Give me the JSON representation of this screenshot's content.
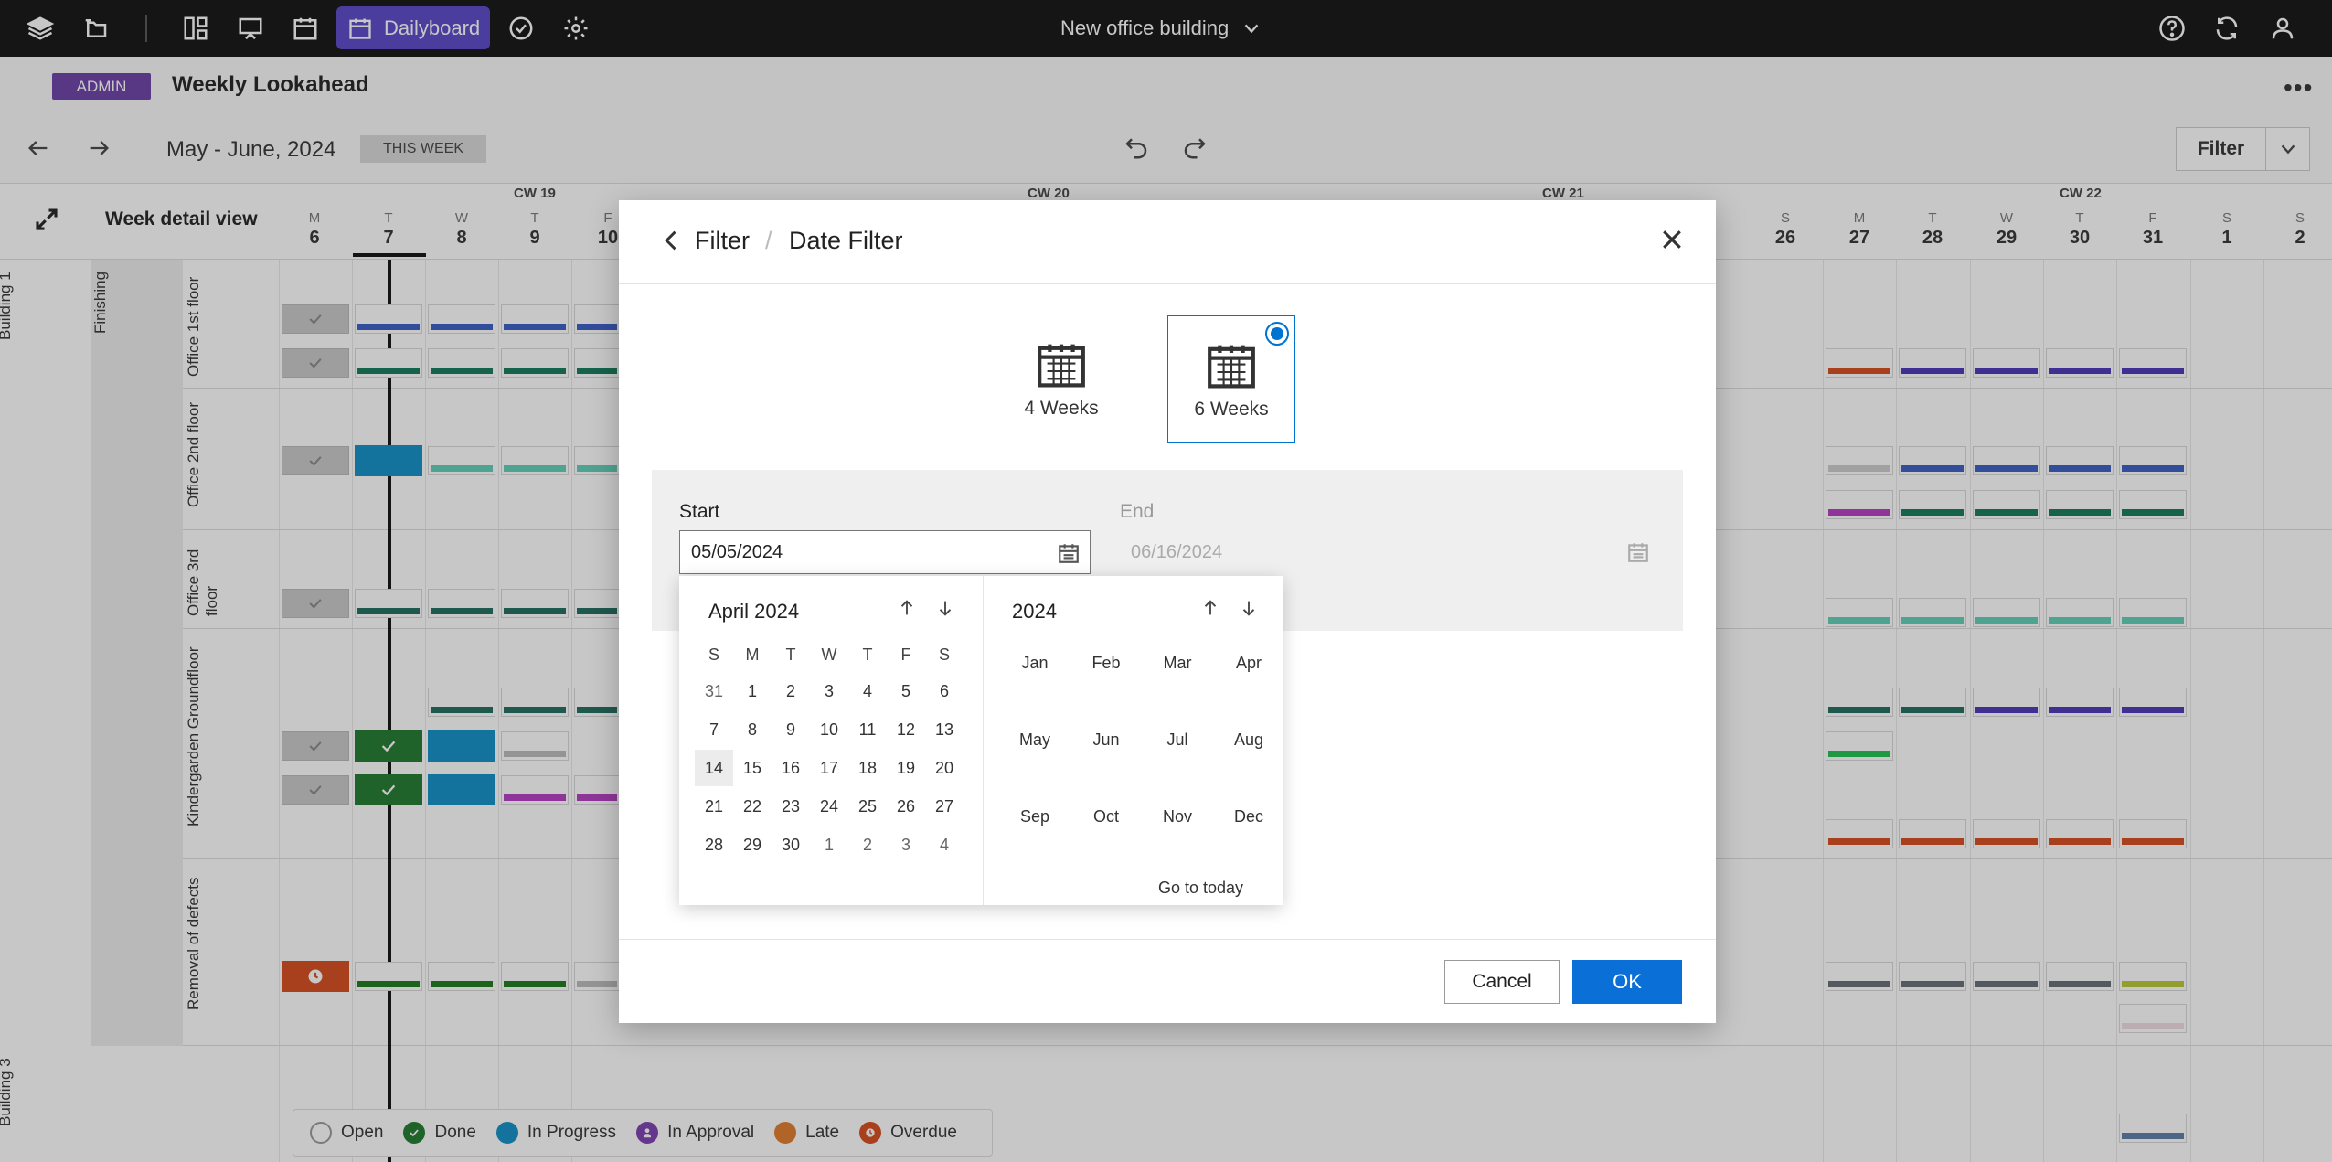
{
  "topbar": {
    "app_tab": "Dailyboard",
    "project_name": "New office building"
  },
  "header": {
    "role_badge": "ADMIN",
    "title": "Weekly Lookahead",
    "date_range": "May - June, 2024",
    "this_week": "THIS WEEK",
    "filter_label": "Filter"
  },
  "grid": {
    "view_label": "Week detail view",
    "calendar_weeks": [
      "CW 19",
      "CW 20",
      "CW 21",
      "CW 22"
    ],
    "days_left": [
      {
        "d": "M",
        "n": "6"
      },
      {
        "d": "T",
        "n": "7"
      },
      {
        "d": "W",
        "n": "8"
      },
      {
        "d": "T",
        "n": "9"
      },
      {
        "d": "F",
        "n": "10"
      }
    ],
    "days_right": [
      {
        "d": "S",
        "n": "26"
      },
      {
        "d": "M",
        "n": "27"
      },
      {
        "d": "T",
        "n": "28"
      },
      {
        "d": "W",
        "n": "29"
      },
      {
        "d": "T",
        "n": "30"
      },
      {
        "d": "F",
        "n": "31"
      },
      {
        "d": "S",
        "n": "1"
      },
      {
        "d": "S",
        "n": "2"
      }
    ],
    "building_1": "Building 1",
    "building_3": "Building 3",
    "section": "Finishing",
    "rows": [
      "Office 1st floor",
      "Office 2nd floor",
      "Office 3rd floor",
      "Kindergarden Groundfloor",
      "Removal of defects"
    ]
  },
  "legend": [
    {
      "label": "Open",
      "color": "#ffffff",
      "border": "#999999"
    },
    {
      "label": "Done",
      "color": "#1f7a2e",
      "border": "#1f7a2e"
    },
    {
      "label": "In Progress",
      "color": "#0f8fc7",
      "border": "#0f8fc7"
    },
    {
      "label": "In Approval",
      "color": "#7b3fb0",
      "border": "#7b3fb0"
    },
    {
      "label": "Late",
      "color": "#e07b2a",
      "border": "#e07b2a"
    },
    {
      "label": "Overdue",
      "color": "#d64a1c",
      "border": "#d64a1c"
    }
  ],
  "modal": {
    "crumb_parent": "Filter",
    "crumb_sep": "/",
    "crumb_current": "Date Filter",
    "options": [
      {
        "label": "4 Weeks",
        "selected": false
      },
      {
        "label": "6 Weeks",
        "selected": true
      }
    ],
    "start_label": "Start",
    "start_value": "05/05/2024",
    "end_label": "End",
    "end_value": "06/16/2024",
    "cancel": "Cancel",
    "ok": "OK",
    "accent": "#0a6fd6"
  },
  "picker": {
    "month_title": "April 2024",
    "year_title": "2024",
    "weekdays": [
      "S",
      "M",
      "T",
      "W",
      "T",
      "F",
      "S"
    ],
    "weeks": [
      [
        "31",
        "1",
        "2",
        "3",
        "4",
        "5",
        "6"
      ],
      [
        "7",
        "8",
        "9",
        "10",
        "11",
        "12",
        "13"
      ],
      [
        "14",
        "15",
        "16",
        "17",
        "18",
        "19",
        "20"
      ],
      [
        "21",
        "22",
        "23",
        "24",
        "25",
        "26",
        "27"
      ],
      [
        "28",
        "29",
        "30",
        "1",
        "2",
        "3",
        "4"
      ]
    ],
    "selected_day": "14",
    "months": [
      "Jan",
      "Feb",
      "Mar",
      "Apr",
      "May",
      "Jun",
      "Jul",
      "Aug",
      "Sep",
      "Oct",
      "Nov",
      "Dec"
    ],
    "go_to_today": "Go to today"
  }
}
